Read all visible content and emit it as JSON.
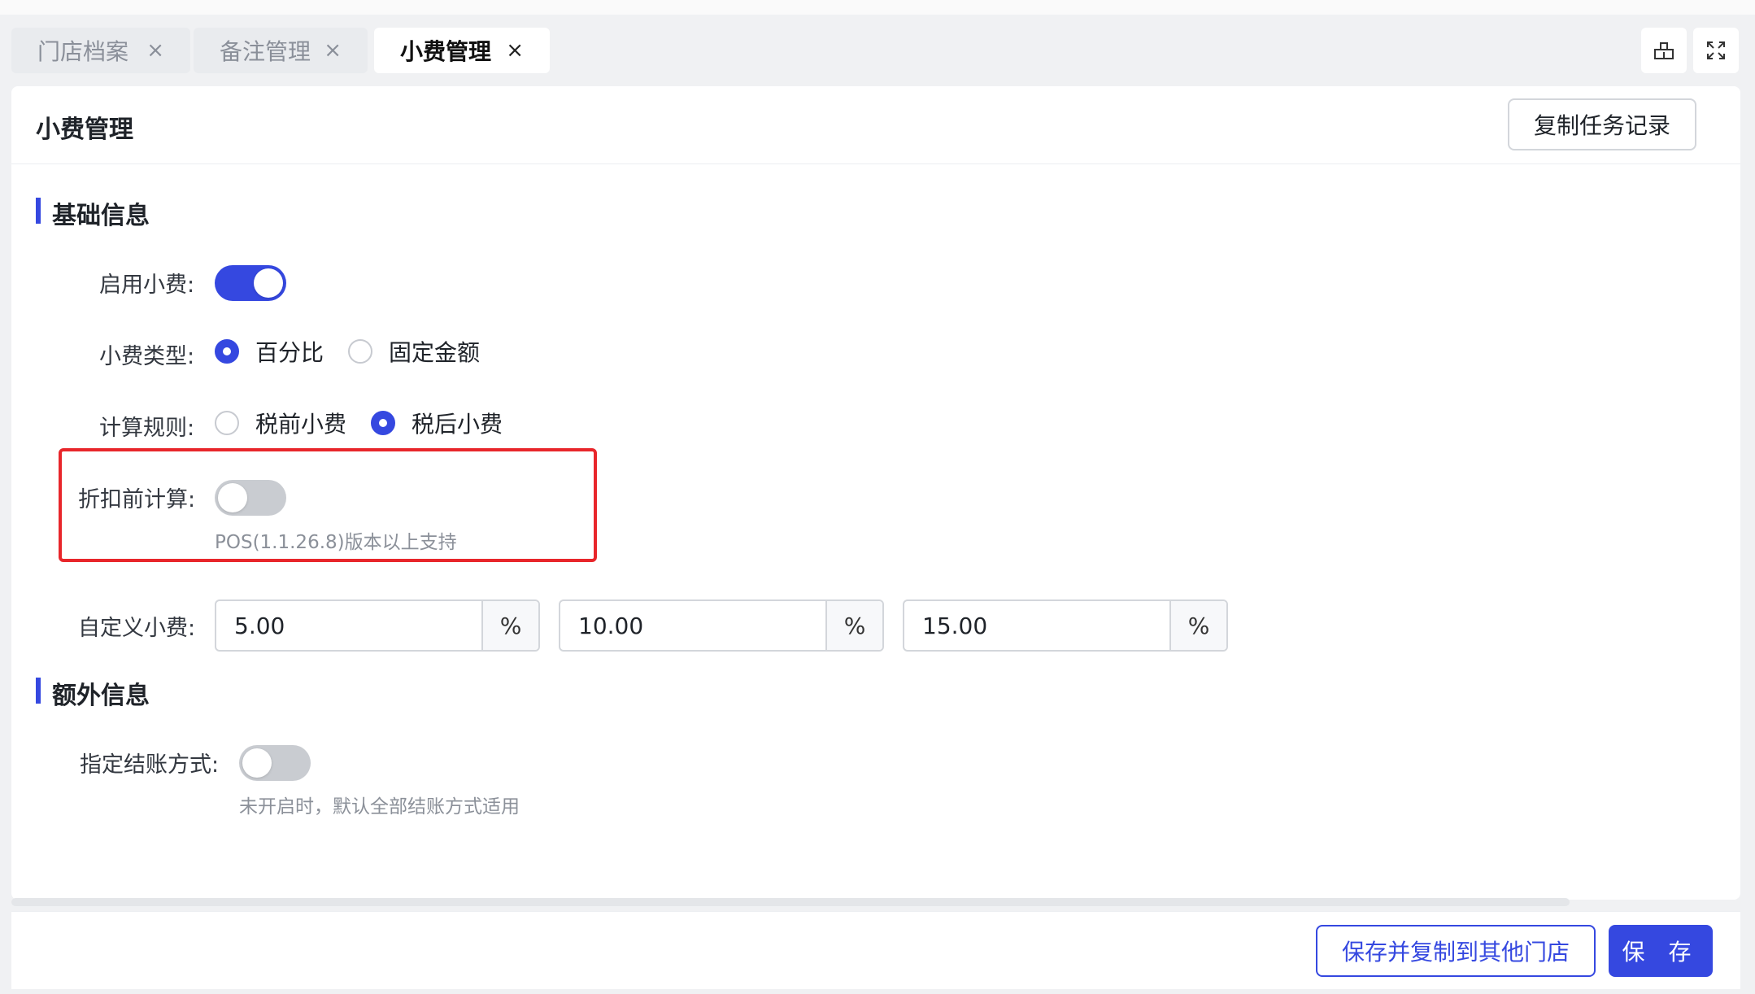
{
  "tabs": [
    {
      "label": "门店档案",
      "active": false
    },
    {
      "label": "备注管理",
      "active": false
    },
    {
      "label": "小费管理",
      "active": true
    }
  ],
  "toolbar": {
    "close_icon": "×"
  },
  "page": {
    "title": "小费管理",
    "copy_log_button": "复制任务记录"
  },
  "basic": {
    "section_title": "基础信息",
    "enable_tip": {
      "label": "启用小费:",
      "on": true
    },
    "tip_type": {
      "label": "小费类型:",
      "options": [
        "百分比",
        "固定金额"
      ],
      "selected": "百分比"
    },
    "calc_rule": {
      "label": "计算规则:",
      "options": [
        "税前小费",
        "税后小费"
      ],
      "selected": "税后小费"
    },
    "pre_discount": {
      "label": "折扣前计算:",
      "on": false,
      "hint": "POS(1.1.26.8)版本以上支持"
    },
    "custom_tip": {
      "label": "自定义小费:",
      "values": [
        "5.00",
        "10.00",
        "15.00"
      ],
      "unit": "%"
    }
  },
  "extra": {
    "section_title": "额外信息",
    "payment_method": {
      "label": "指定结账方式:",
      "on": false,
      "hint": "未开启时，默认全部结账方式适用"
    }
  },
  "footer": {
    "save_copy_button": "保存并复制到其他门店",
    "save_button": "保 存"
  },
  "colors": {
    "primary": "#3548e0",
    "highlight_border": "#e8262b"
  }
}
